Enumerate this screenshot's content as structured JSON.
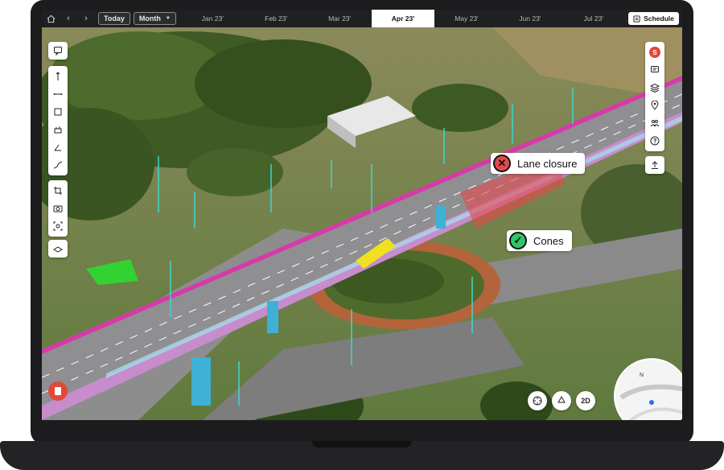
{
  "topbar": {
    "today_label": "Today",
    "view_label": "Month",
    "months": [
      {
        "label": "Jan 23'",
        "active": false
      },
      {
        "label": "Feb 23'",
        "active": false
      },
      {
        "label": "Mar 23'",
        "active": false
      },
      {
        "label": "Apr 23'",
        "active": true
      },
      {
        "label": "May 23'",
        "active": false
      },
      {
        "label": "Jun 23'",
        "active": false
      },
      {
        "label": "Jul 23'",
        "active": false
      }
    ],
    "schedule_label": "Schedule"
  },
  "right_toolbar": {
    "avatar_initial": "S"
  },
  "callouts": {
    "lane_closure": {
      "label": "Lane closure",
      "color": "#e5484d"
    },
    "cones": {
      "label": "Cones",
      "color": "#30c46a"
    }
  },
  "bottom_controls": {
    "view_2d_label": "2D"
  },
  "colors": {
    "road_edge": "#d63aa8",
    "barrier": "#a8d8e8",
    "cyan_markers": "#3fd6cf",
    "accent_red": "#e0493a"
  }
}
